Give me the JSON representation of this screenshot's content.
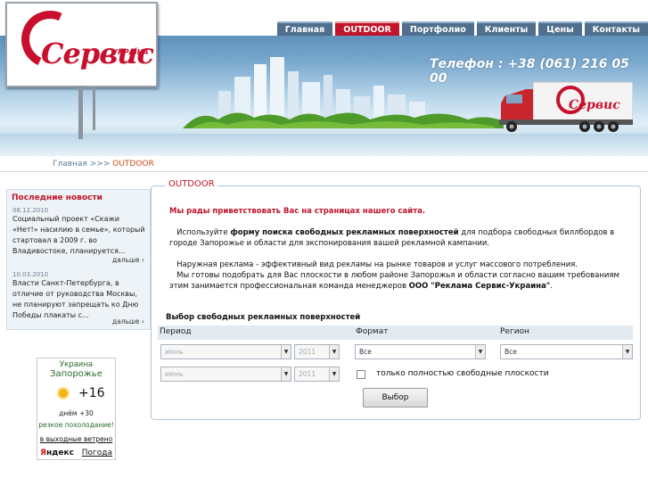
{
  "header": {
    "logo_text": "Сервис",
    "logo_sub": "УКРАЇНА",
    "phone": "Телефон : +38 (061) 216 05 00",
    "truck_logo": "Сервис"
  },
  "nav": {
    "items": [
      {
        "label": "Главная"
      },
      {
        "label": "OUTDOOR"
      },
      {
        "label": "Портфолио"
      },
      {
        "label": "Клиенты"
      },
      {
        "label": "Цены"
      },
      {
        "label": "Контакты"
      }
    ],
    "active_index": 1,
    "active_color": "#c0152a",
    "color": "#4f6f8c"
  },
  "breadcrumb": {
    "home": "Главная",
    "separator": ">>>",
    "current": "OUTDOOR"
  },
  "news": {
    "title": "Последние новости",
    "items": [
      {
        "date": "08.12.2010",
        "text": "Социальный проект «Скажи «Нет!» насилию в семье», который стартовал в 2009 г. во Владивостоке, планируется...",
        "more": "дальше"
      },
      {
        "date": "10.03.2010",
        "text": "Власти Санкт-Петербурга, в отличие от руководства Москвы, не планируют запрещать ко Дню Победы плакаты с...",
        "more": "дальше"
      }
    ]
  },
  "weather": {
    "country": "Украина",
    "city": "Запорожье",
    "temp": "+16",
    "night": "днём +30",
    "condition": "резкое похолодание!",
    "weekend": "в выходные ветрено",
    "brand_ya": "Я",
    "brand_rest": "ндекс",
    "link": "Погода"
  },
  "main": {
    "title": "OUTDOOR",
    "welcome": "Мы рады приветствовать Вас на страницах нашего сайта.",
    "p1_pre": "Используйте ",
    "p1_bold": "форму поиска свободных рекламных поверхностей",
    "p1_post": " для подбора свободных биллбордов в городе Запорожье и области для экспонирования вашей рекламной кампании.",
    "p2_line1": "Наружная реклама - эффективный вид рекламы на рынке товаров и услуг массового потребления.",
    "p2_line2": "Мы готовы подобрать для Вас плоскости в любом районе Запорожья и области согласно вашим требованиям этим занимается профессиональная команда менеджеров ",
    "p2_bold": "ООО \"Реклама Сервис-Украина\"",
    "p2_end": "."
  },
  "form": {
    "title": "Выбор свободных рекламных поверхностей",
    "headers": {
      "period": "Период",
      "format": "Формат",
      "region": "Регион"
    },
    "period_from_month": "июнь",
    "period_from_year": "2011",
    "period_to_month": "июнь",
    "period_to_year": "2011",
    "format_value": "Все",
    "region_value": "Все",
    "checkbox_label": "только полностью свободные плоскости",
    "submit_label": "Выбор"
  }
}
